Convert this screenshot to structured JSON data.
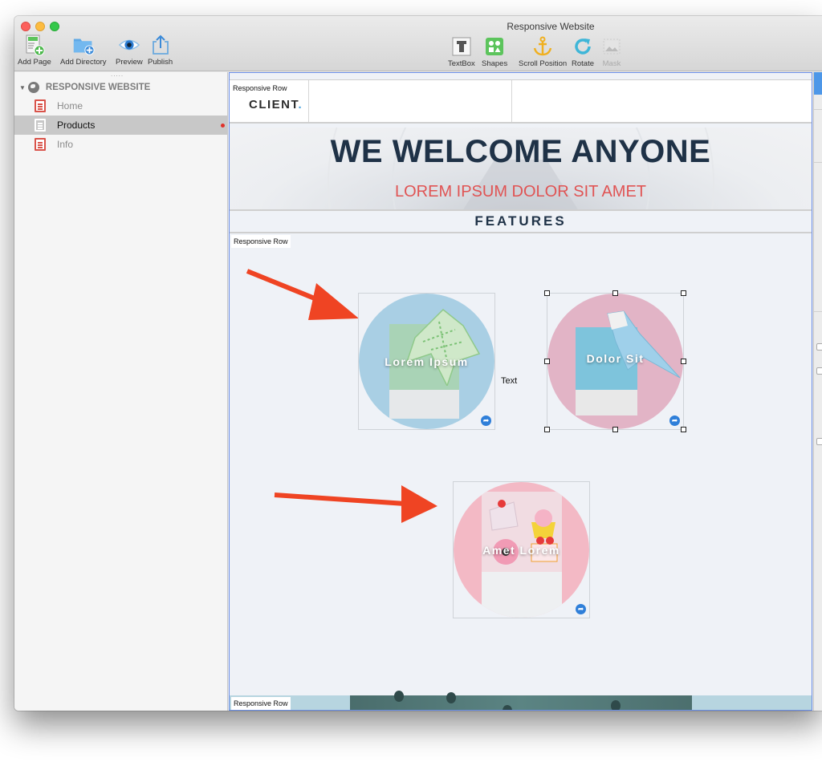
{
  "window": {
    "title": "Responsive Website"
  },
  "toolbar": {
    "left_tools": [
      {
        "id": "add-page",
        "label": "Add Page",
        "icon": "add-page-icon"
      },
      {
        "id": "add-directory",
        "label": "Add Directory",
        "icon": "add-directory-icon"
      },
      {
        "id": "preview",
        "label": "Preview",
        "icon": "eye-icon"
      },
      {
        "id": "publish",
        "label": "Publish",
        "icon": "share-icon"
      }
    ],
    "center_tools": [
      {
        "id": "textbox",
        "label": "TextBox",
        "icon": "textbox-icon",
        "enabled": true
      },
      {
        "id": "shapes",
        "label": "Shapes",
        "icon": "shapes-icon",
        "enabled": true
      },
      {
        "id": "scroll-position",
        "label": "Scroll Position",
        "icon": "anchor-icon",
        "enabled": true
      },
      {
        "id": "rotate",
        "label": "Rotate",
        "icon": "rotate-icon",
        "enabled": true
      },
      {
        "id": "mask",
        "label": "Mask",
        "icon": "mask-icon",
        "enabled": false
      }
    ]
  },
  "sidebar": {
    "grip": ".....",
    "root": {
      "label": "RESPONSIVE WEBSITE",
      "icon": "globe-icon",
      "expanded": true
    },
    "pages": [
      {
        "label": "Home",
        "selected": false,
        "modified": false
      },
      {
        "label": "Products",
        "selected": true,
        "modified": true
      },
      {
        "label": "Info",
        "selected": false,
        "modified": false
      }
    ]
  },
  "canvas": {
    "header_row": {
      "row_label": "Responsive Row",
      "logo_text": "CLIENT",
      "logo_dot": "."
    },
    "hero": {
      "title": "WE WELCOME ANYONE",
      "subtitle": "LOREM IPSUM DOLOR SIT AMET"
    },
    "features_heading": "FEATURES",
    "features_row": {
      "row_label": "Responsive Row",
      "cards": [
        {
          "label": "Lorem Ipsum",
          "image": "origami-frog",
          "selected": false
        },
        {
          "label": "Dolor Sit",
          "image": "origami-bird",
          "selected": true
        },
        {
          "label": "Amet Lorem",
          "image": "desserts",
          "selected": false
        }
      ],
      "free_text": "Text"
    },
    "bottom_row": {
      "row_label": "Responsive Row"
    }
  },
  "colors": {
    "accent_blue": "#6b8ee8",
    "hero_title": "#1f3247",
    "hero_subtitle": "#e05454",
    "annotation_arrow": "#ef4423",
    "modified_dot": "#e0302a"
  }
}
